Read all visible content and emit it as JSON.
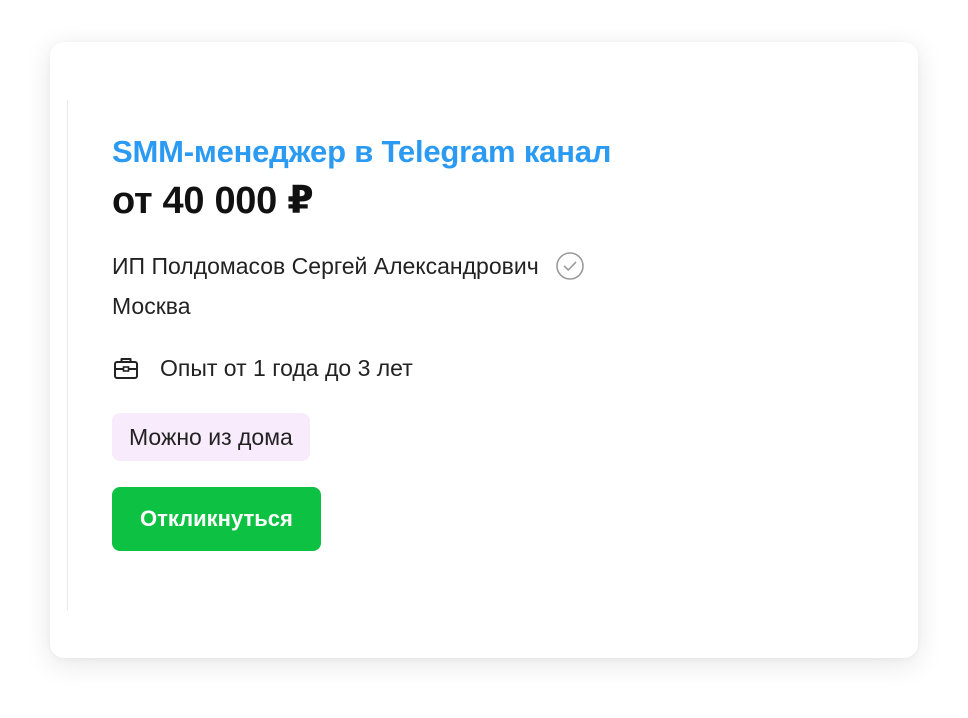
{
  "vacancy": {
    "title": "SMM-менеджер в Telegram канал",
    "salary": "от 40 000 ₽",
    "employer": "ИП Полдомасов Сергей Александрович",
    "city": "Москва",
    "experience": "Опыт от 1 года до 3 лет",
    "tag": "Можно из дома",
    "respond_label": "Откликнуться"
  },
  "icons": {
    "verified": "check-circle-icon",
    "experience": "briefcase-icon"
  },
  "colors": {
    "title": "#2b9af3",
    "button": "#0dc142",
    "tag_background": "#f8ebfc"
  }
}
